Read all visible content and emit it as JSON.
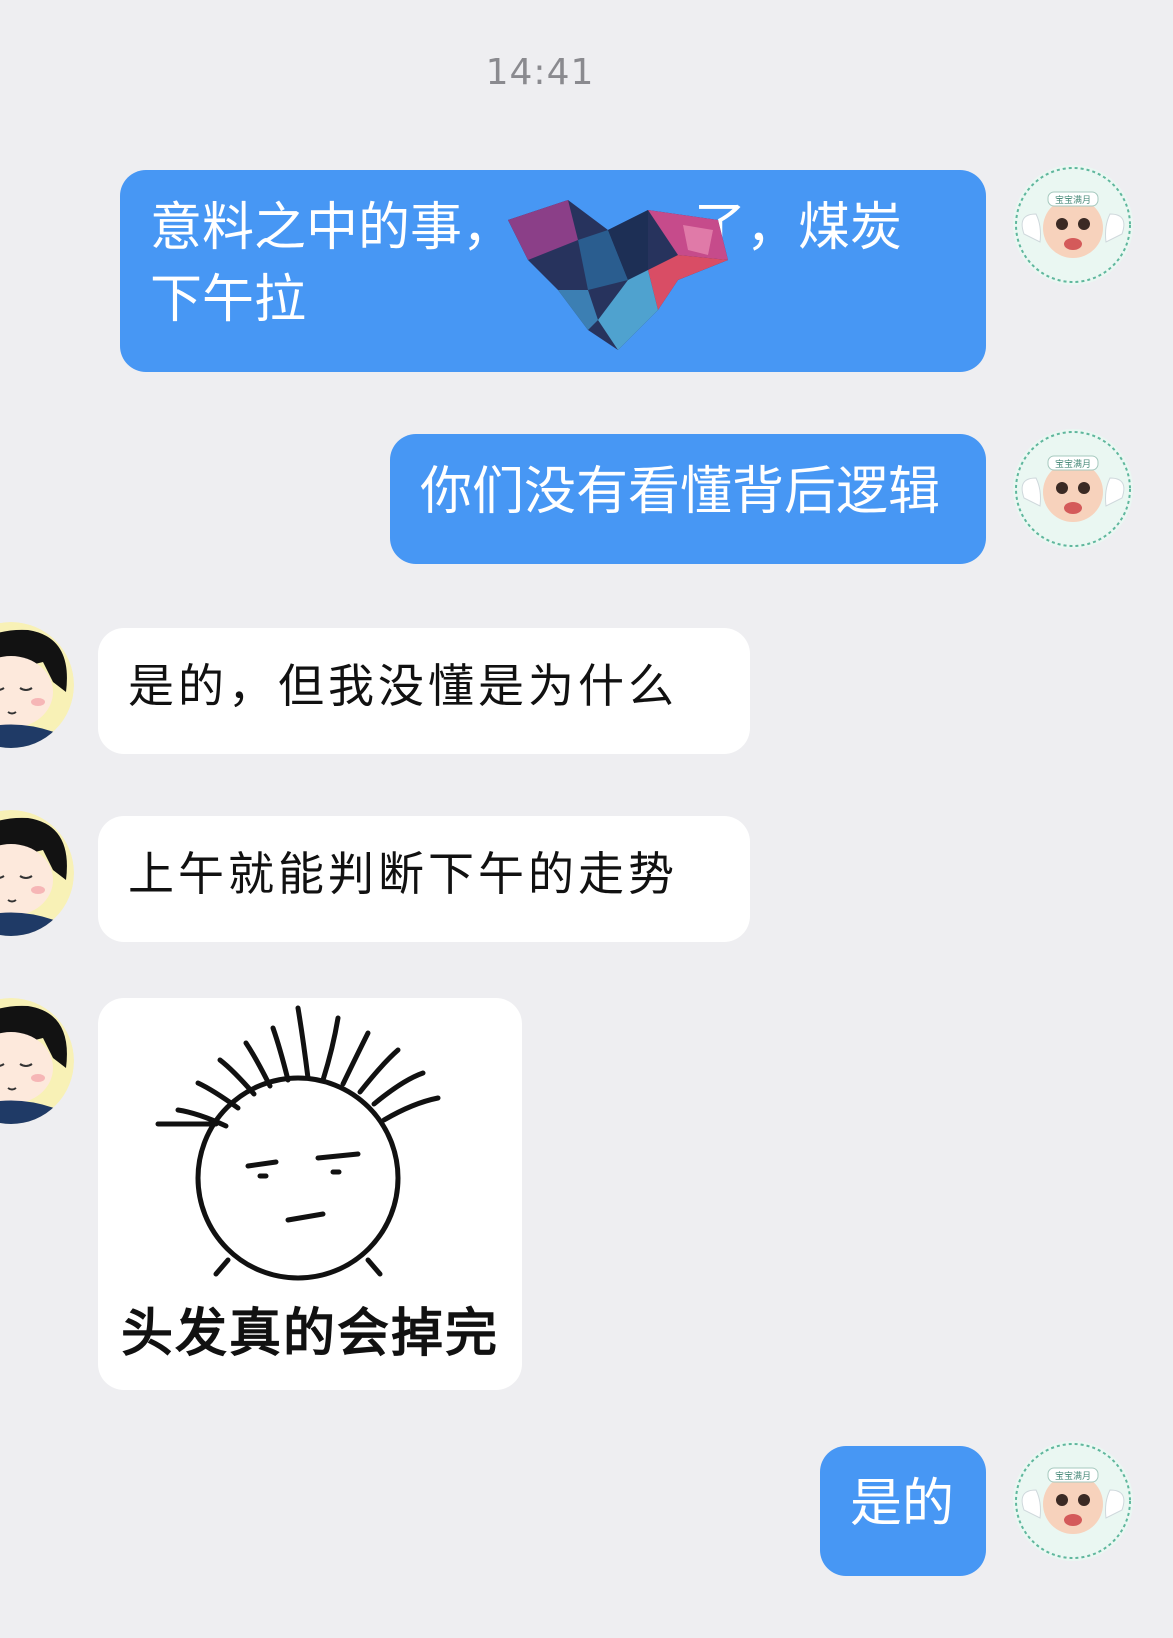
{
  "timestamp": "14:41",
  "messages": [
    {
      "side": "me",
      "text": "意料之中的事，…了，煤炭\n下午拉",
      "line1": "意料之中的事，",
      "line1b": "了，煤炭",
      "line2": "下午拉"
    },
    {
      "side": "me",
      "text": "你们没有看懂背后逻辑"
    },
    {
      "side": "other",
      "text": "是的，但我没懂是为什么"
    },
    {
      "side": "other",
      "text": "上午就能判断下午的走势"
    },
    {
      "side": "other",
      "type": "sticker",
      "caption": "头发真的会掉完"
    },
    {
      "side": "me",
      "text": "是的"
    }
  ],
  "avatars": {
    "me": {
      "icon": "baby-angel-avatar-icon",
      "label": "宝宝满月"
    },
    "other": {
      "icon": "cartoon-girl-avatar-icon"
    }
  },
  "colors": {
    "background": "#eeeef1",
    "my_bubble": "#4797f4",
    "other_bubble": "#ffffff"
  }
}
